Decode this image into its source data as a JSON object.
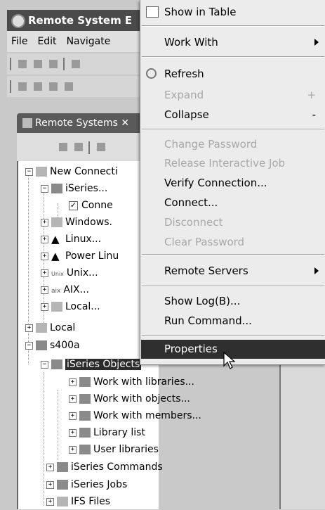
{
  "window": {
    "title": "Remote System E"
  },
  "menubar": {
    "items": [
      "File",
      "Edit",
      "Navigate"
    ]
  },
  "view": {
    "tab_label": "Remote Systems",
    "close_glyph": "✕"
  },
  "tree": {
    "new_connection": "New Connecti",
    "iseries_dots": "iSeries...",
    "conne": "Conne",
    "windows": "Windows.",
    "linux": "Linux...",
    "power_linux": "Power Linu",
    "unix": "Unix...",
    "aix": "AIX...",
    "local_dots": "Local...",
    "local": "Local",
    "s400a": "s400a",
    "iseries_objects": "iSeries Objects",
    "work_libraries": "Work with libraries...",
    "work_objects": "Work with objects...",
    "work_members": "Work with members...",
    "library_list": "Library list",
    "user_libraries": "User libraries",
    "iseries_commands": "iSeries Commands",
    "iseries_jobs": "iSeries Jobs",
    "ifs_files": "IFS Files",
    "unix_badge": "Unix",
    "aix_badge": "aix"
  },
  "context_menu": {
    "show_in_table": "Show in Table",
    "work_with": "Work With",
    "refresh": "Refresh",
    "expand": "Expand",
    "expand_accel": "+",
    "collapse": "Collapse",
    "collapse_accel": "-",
    "change_password": "Change Password",
    "release_interactive_job": "Release Interactive Job",
    "verify_connection": "Verify Connection...",
    "connect": "Connect...",
    "disconnect": "Disconnect",
    "clear_password": "Clear Password",
    "remote_servers": "Remote Servers",
    "show_log": "Show Log(B)...",
    "run_command": "Run Command...",
    "properties": "Properties"
  },
  "colors": {
    "menu_highlight": "#2f2f2f",
    "selection": "#2b2b2b",
    "title_bar": "#4a4a4a"
  }
}
